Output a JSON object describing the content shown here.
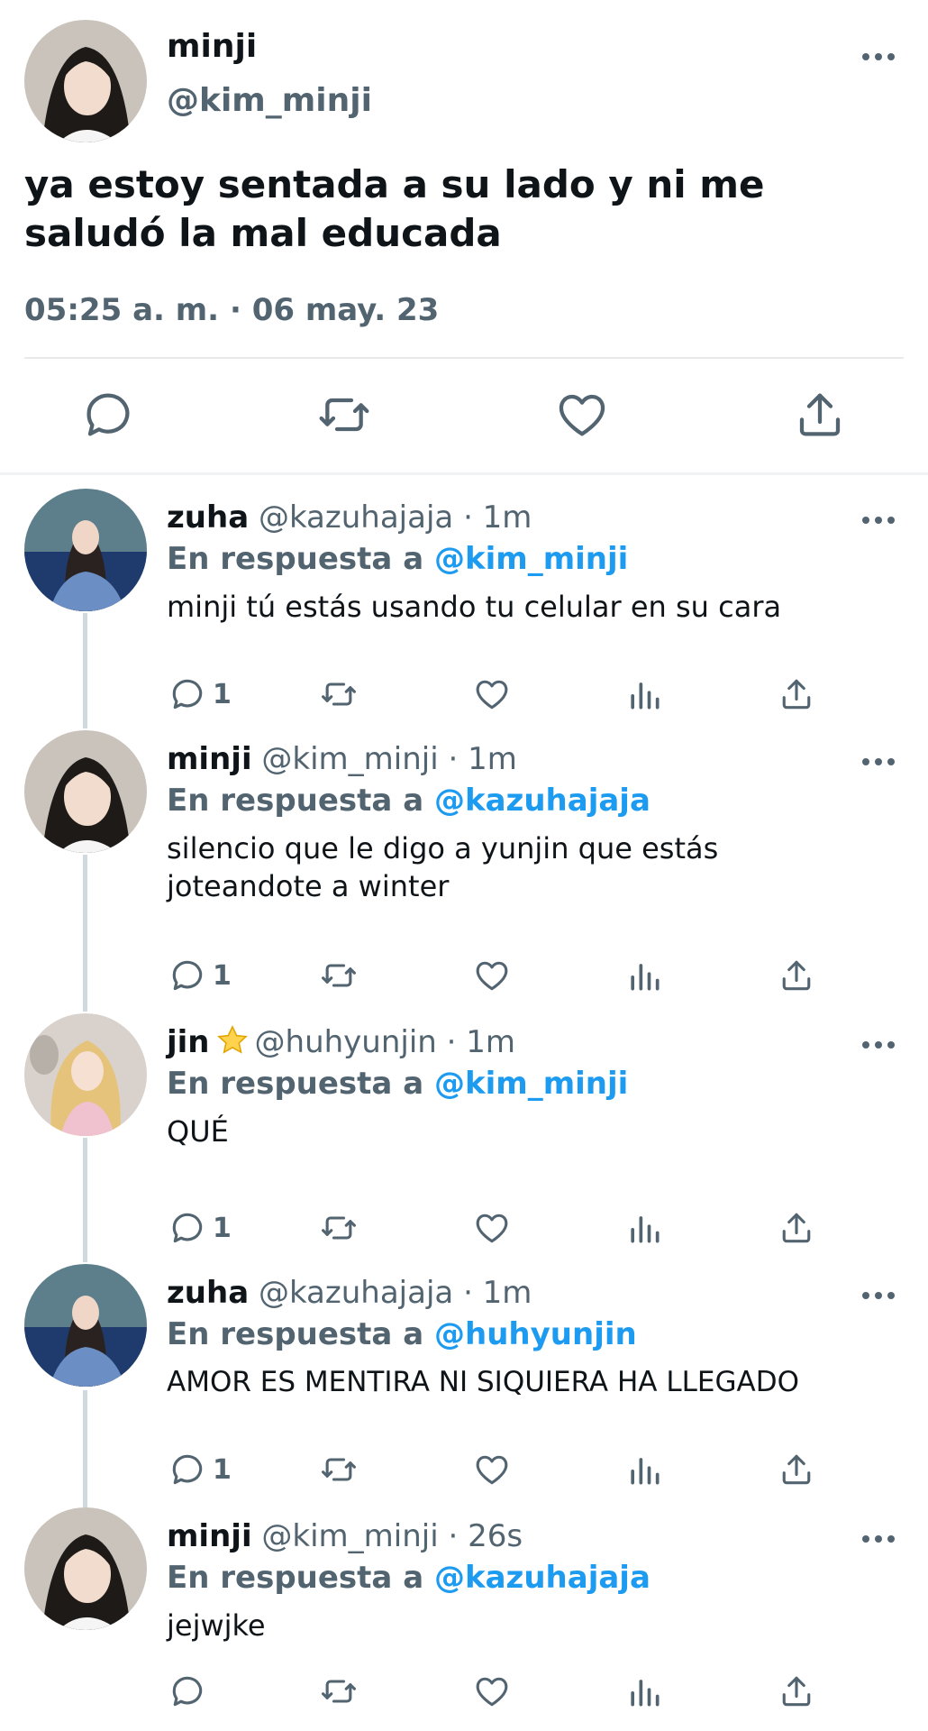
{
  "main_tweet": {
    "name": "minji",
    "handle": "@kim_minji",
    "text": "ya estoy sentada a su lado y ni me saludó la mal educada",
    "timestamp": "05:25 a. m. · 06 may. 23",
    "actions": [
      "reply-icon",
      "retweet-icon",
      "like-icon",
      "share-icon"
    ]
  },
  "colors": {
    "text": "#0f1419",
    "secondary": "#536471",
    "link": "#1d9bf0",
    "divider": "#e7e9ea",
    "thread_line": "#cfd9de"
  },
  "replies": [
    {
      "name": "zuha",
      "handle": "@kazuhajaja",
      "time": "· 1m",
      "reply_label": "En respuesta a",
      "reply_to": "@kim_minji",
      "text": "minji tú estás usando tu celular en su cara",
      "reply_count": "1"
    },
    {
      "name": "minji",
      "handle": "@kim_minji",
      "time": "· 1m",
      "reply_label": "En respuesta a",
      "reply_to": "@kazuhajaja",
      "text": "silencio que le digo a yunjin que estás joteandote a winter",
      "reply_count": "1"
    },
    {
      "name": "jin",
      "handle": "@huhyunjin",
      "time": "· 1m",
      "reply_label": "En respuesta a",
      "reply_to": "@kim_minji",
      "text": "QUÉ",
      "reply_count": "1"
    },
    {
      "name": "zuha",
      "handle": "@kazuhajaja",
      "time": "· 1m",
      "reply_label": "En respuesta a",
      "reply_to": "@huhyunjin",
      "text": "AMOR ES MENTIRA NI SIQUIERA HA LLEGADO",
      "reply_count": "1"
    },
    {
      "name": "minji",
      "handle": "@kim_minji",
      "time": "· 26s",
      "reply_label": "En respuesta a",
      "reply_to": "@kazuhajaja",
      "text": "jejwjke",
      "reply_count": ""
    }
  ]
}
